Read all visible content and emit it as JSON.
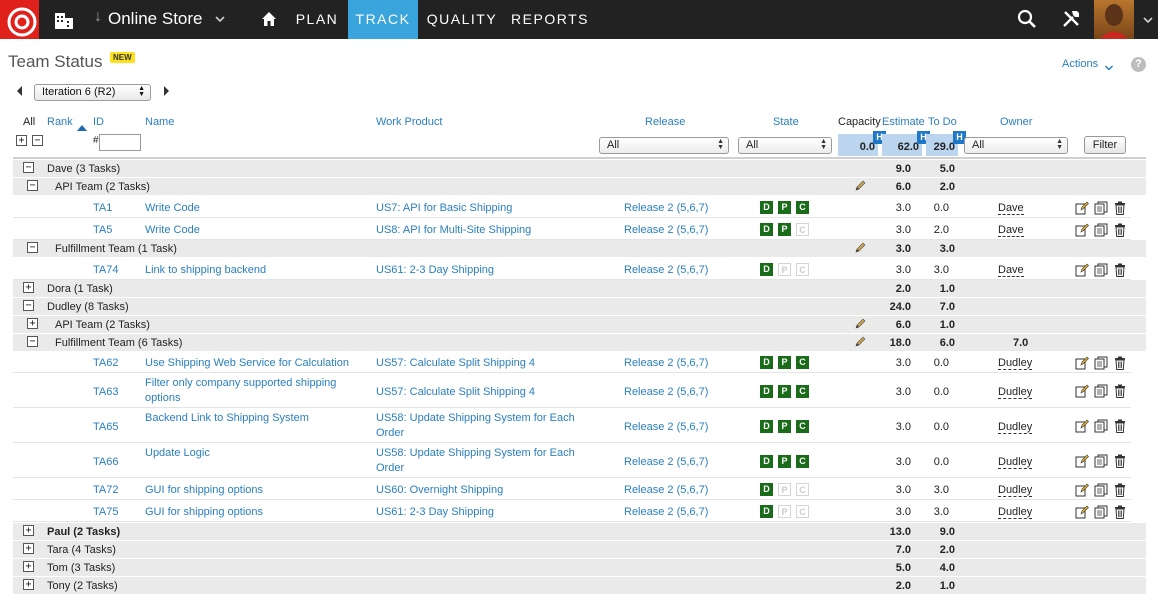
{
  "nav": {
    "project": "Online Store",
    "tabs": [
      "PLAN",
      "TRACK",
      "QUALITY",
      "REPORTS"
    ],
    "active_tab": "TRACK"
  },
  "page": {
    "title": "Team Status",
    "badge": "NEW",
    "actions": "Actions",
    "help": "?",
    "iteration": "Iteration 6 (R2)"
  },
  "columns": {
    "all": "All",
    "rank": "Rank",
    "id": "ID",
    "name": "Name",
    "work_product": "Work Product",
    "release": "Release",
    "state": "State",
    "capacity": "Capacity",
    "estimate": "Estimate",
    "todo": "To Do",
    "owner": "Owner"
  },
  "filters": {
    "id_hash": "#",
    "release": "All",
    "state": "All",
    "owner": "All",
    "capacity_total": "0.0",
    "estimate_total": "62.0",
    "todo_total": "29.0",
    "h_badge": "H",
    "filter_button": "Filter"
  },
  "rows": [
    {
      "type": "owner",
      "toggle": "−",
      "label": "Dave  (3 Tasks)",
      "estimate": "9.0",
      "todo": "5.0"
    },
    {
      "type": "team",
      "toggle": "−",
      "label": "API Team  (2 Tasks)",
      "estimate": "6.0",
      "todo": "2.0"
    },
    {
      "type": "task",
      "id": "TA1",
      "name": "Write Code",
      "wp": "US7: API for Basic Shipping",
      "release": "Release 2 (5,6,7)",
      "state": [
        1,
        1,
        1
      ],
      "estimate": "3.0",
      "todo": "0.0",
      "owner": "Dave"
    },
    {
      "type": "task",
      "id": "TA5",
      "name": "Write Code",
      "wp": "US8: API for Multi-Site Shipping",
      "release": "Release 2 (5,6,7)",
      "state": [
        1,
        1,
        0
      ],
      "estimate": "3.0",
      "todo": "2.0",
      "owner": "Dave"
    },
    {
      "type": "team",
      "toggle": "−",
      "label": "Fulfillment Team  (1 Task)",
      "estimate": "3.0",
      "todo": "3.0"
    },
    {
      "type": "task",
      "id": "TA74",
      "name": "Link to shipping backend",
      "wp": "US61: 2-3 Day Shipping",
      "release": "Release 2 (5,6,7)",
      "state": [
        1,
        0,
        0
      ],
      "estimate": "3.0",
      "todo": "3.0",
      "owner": "Dave"
    },
    {
      "type": "owner",
      "toggle": "+",
      "label": "Dora  (1 Task)",
      "estimate": "2.0",
      "todo": "1.0"
    },
    {
      "type": "owner",
      "toggle": "−",
      "label": "Dudley  (8 Tasks)",
      "estimate": "24.0",
      "todo": "7.0"
    },
    {
      "type": "team",
      "toggle": "+",
      "label": "API Team  (2 Tasks)",
      "estimate": "6.0",
      "todo": "1.0"
    },
    {
      "type": "team",
      "toggle": "−",
      "label": "Fulfillment Team  (6 Tasks)",
      "estimate": "18.0",
      "todo": "6.0",
      "owner_val": "7.0"
    },
    {
      "type": "task",
      "id": "TA62",
      "name": "Use Shipping Web Service for Calculation",
      "wp": "US57: Calculate Split Shipping 4",
      "release": "Release 2 (5,6,7)",
      "state": [
        1,
        1,
        1
      ],
      "estimate": "3.0",
      "todo": "0.0",
      "owner": "Dudley"
    },
    {
      "type": "task",
      "id": "TA63",
      "name": "Filter only company supported shipping options",
      "wp": "US57: Calculate Split Shipping 4",
      "release": "Release 2 (5,6,7)",
      "state": [
        1,
        1,
        1
      ],
      "estimate": "3.0",
      "todo": "0.0",
      "owner": "Dudley"
    },
    {
      "type": "task",
      "id": "TA65",
      "name": "Backend Link to Shipping System",
      "wp": "US58: Update Shipping System for Each Order",
      "release": "Release 2 (5,6,7)",
      "state": [
        1,
        1,
        1
      ],
      "estimate": "3.0",
      "todo": "0.0",
      "owner": "Dudley"
    },
    {
      "type": "task",
      "id": "TA66",
      "name": "Update Logic",
      "wp": "US58: Update Shipping System for Each Order",
      "release": "Release 2 (5,6,7)",
      "state": [
        1,
        1,
        1
      ],
      "estimate": "3.0",
      "todo": "0.0",
      "owner": "Dudley"
    },
    {
      "type": "task",
      "id": "TA72",
      "name": "GUI for shipping options",
      "wp": "US60: Overnight Shipping",
      "release": "Release 2 (5,6,7)",
      "state": [
        1,
        0,
        0
      ],
      "estimate": "3.0",
      "todo": "3.0",
      "owner": "Dudley"
    },
    {
      "type": "task",
      "id": "TA75",
      "name": "GUI for shipping options",
      "wp": "US61: 2-3 Day Shipping",
      "release": "Release 2 (5,6,7)",
      "state": [
        1,
        0,
        0
      ],
      "estimate": "3.0",
      "todo": "3.0",
      "owner": "Dudley"
    },
    {
      "type": "owner",
      "toggle": "+",
      "label": "Paul  (2 Tasks)",
      "estimate": "13.0",
      "todo": "9.0",
      "bold": true
    },
    {
      "type": "owner",
      "toggle": "+",
      "label": "Tara  (4 Tasks)",
      "estimate": "7.0",
      "todo": "2.0"
    },
    {
      "type": "owner",
      "toggle": "+",
      "label": "Tom  (3 Tasks)",
      "estimate": "5.0",
      "todo": "4.0"
    },
    {
      "type": "owner",
      "toggle": "+",
      "label": "Tony  (2 Tasks)",
      "estimate": "2.0",
      "todo": "1.0"
    }
  ],
  "state_letters": [
    "D",
    "P",
    "C"
  ],
  "colors": {
    "nav_bg": "#222222",
    "active_tab": "#3aa5dd",
    "logo": "#e0201b",
    "link": "#2a7fbf",
    "state_on": "#1a6b1a",
    "group_bg": "#eaeaea",
    "summary_bg": "#bcd5ef"
  },
  "icons": [
    "logo-icon",
    "workspace-icon",
    "home-icon",
    "search-icon",
    "tools-icon",
    "pencil-icon",
    "edit-icon",
    "copy-icon",
    "delete-icon"
  ]
}
